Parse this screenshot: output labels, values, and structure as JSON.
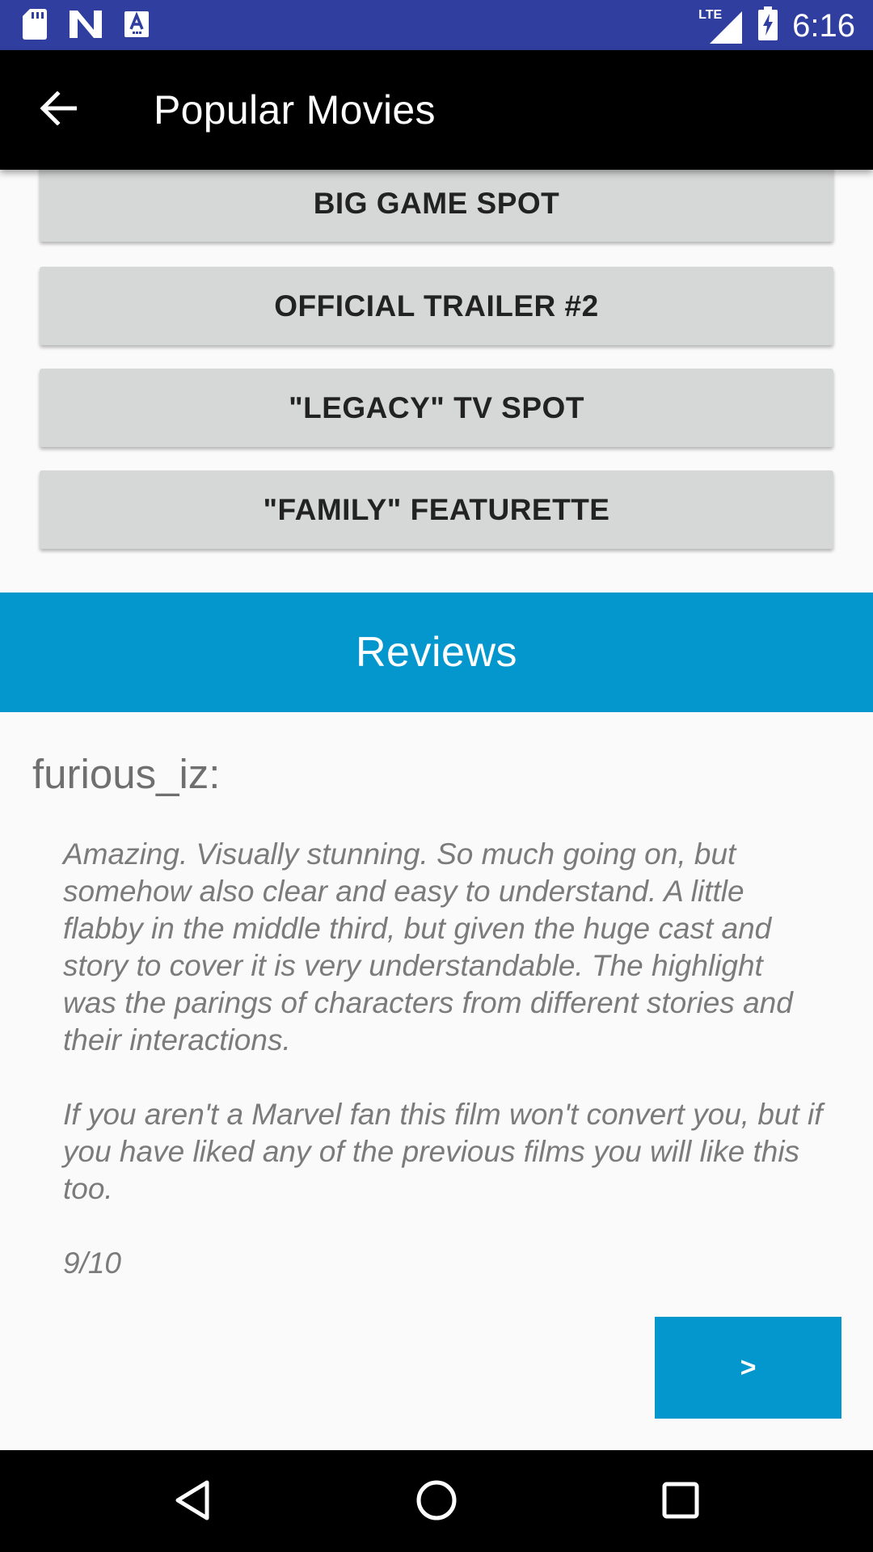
{
  "status_bar": {
    "time": "6:16",
    "network_label": "LTE",
    "icons_left": [
      "sd-card-icon",
      "n-logo-icon",
      "keyboard-a-icon"
    ],
    "icons_right": [
      "signal-icon",
      "battery-charging-icon"
    ],
    "background": "#303f9f"
  },
  "toolbar": {
    "back_icon": "arrow-back-icon",
    "title": "Popular Movies"
  },
  "trailers": [
    {
      "label": "BIG GAME SPOT"
    },
    {
      "label": "OFFICIAL TRAILER #2"
    },
    {
      "label": "\"LEGACY\" TV SPOT"
    },
    {
      "label": "\"FAMILY\" FEATURETTE"
    }
  ],
  "reviews": {
    "header": "Reviews",
    "accent": "#0397cd",
    "author": "furious_iz:",
    "paragraphs": [
      "Amazing.  Visually stunning.  So much going on, but somehow also clear and easy to understand.  A little flabby in the middle third, but given the huge cast and story to cover it is very understandable.  The highlight was the parings of characters from different stories and their interactions.",
      "If you aren't a Marvel fan this film won't convert you, but if you have liked any of the previous films you will like this too.",
      "9/10"
    ],
    "next_label": ">"
  },
  "nav_bar": {
    "icons": [
      "nav-back-icon",
      "nav-home-icon",
      "nav-recents-icon"
    ]
  }
}
